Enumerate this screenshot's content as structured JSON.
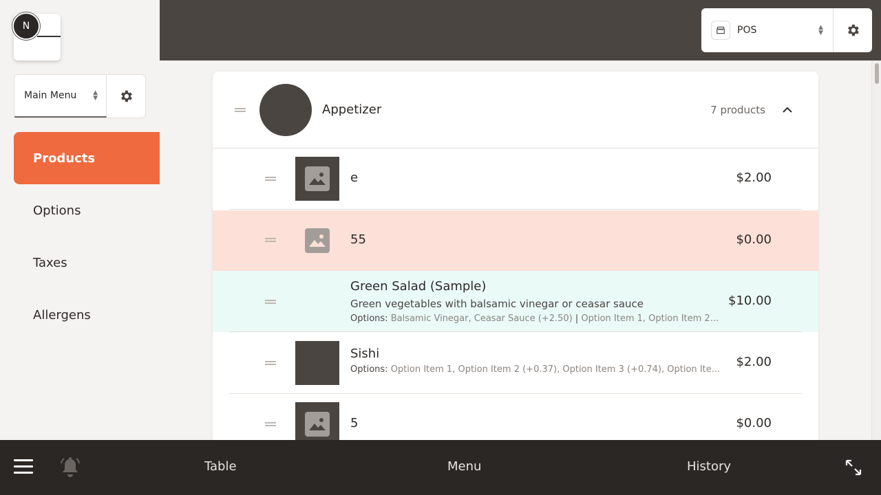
{
  "user": {
    "initial": "N"
  },
  "menu_selector": {
    "value": "Main Menu"
  },
  "sidebar": {
    "items": [
      {
        "label": "Products",
        "active": true
      },
      {
        "label": "Options"
      },
      {
        "label": "Taxes"
      },
      {
        "label": "Allergens"
      }
    ]
  },
  "pos_selector": {
    "value": "POS"
  },
  "category": {
    "name": "Appetizer",
    "count": "7 products"
  },
  "products": [
    {
      "name": "e",
      "price": "$2.00"
    },
    {
      "name": "55",
      "price": "$0.00"
    },
    {
      "name": "Green Salad (Sample)",
      "description": "Green vegetables with balsamic vinegar or ceasar sauce",
      "options_label": "Options:",
      "options_a": "Balsamic Vinegar, Ceasar Sauce (+2.50)",
      "options_sep": " | ",
      "options_b": "Option Item 1, Option Item 2...",
      "price": "$10.00"
    },
    {
      "name": "Sishi",
      "options_label": "Options:",
      "options_a": "Option Item 1, Option Item 2 (+0.37), Option Item 3 (+0.74), Option Ite...",
      "price": "$2.00"
    },
    {
      "name": "5",
      "price": "$0.00"
    }
  ],
  "bottom_nav": {
    "table": "Table",
    "menu": "Menu",
    "history": "History"
  },
  "colors": {
    "accent": "#ef6a3e",
    "highlight_pink": "#fde0d7",
    "highlight_mint": "#eafaf7",
    "dark": "#4b4542"
  }
}
